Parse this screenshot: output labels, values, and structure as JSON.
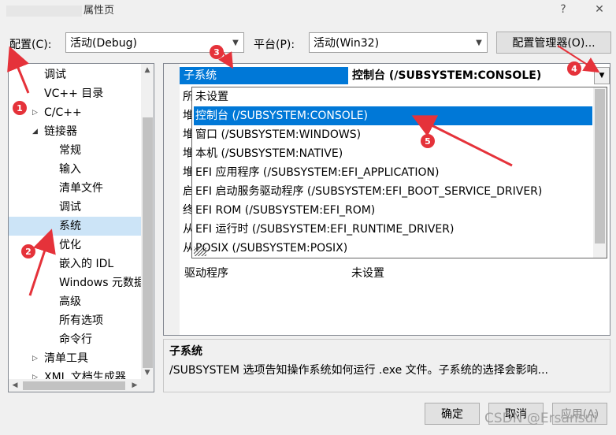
{
  "window": {
    "title": "属性页",
    "help_glyph": "?",
    "close_glyph": "✕"
  },
  "config": {
    "label": "配置(C):",
    "value": "活动(Debug)"
  },
  "platform": {
    "label": "平台(P):",
    "value": "活动(Win32)"
  },
  "config_manager_label": "配置管理器(O)...",
  "tree": {
    "items": [
      {
        "label": "调试",
        "indent": 0
      },
      {
        "label": "VC++ 目录",
        "indent": 0
      },
      {
        "label": "C/C++",
        "indent": 0,
        "expander": "▷"
      },
      {
        "label": "链接器",
        "indent": 0,
        "expander": "◢"
      },
      {
        "label": "常规",
        "indent": 1
      },
      {
        "label": "输入",
        "indent": 1
      },
      {
        "label": "清单文件",
        "indent": 1
      },
      {
        "label": "调试",
        "indent": 1
      },
      {
        "label": "系统",
        "indent": 1,
        "selected": true
      },
      {
        "label": "优化",
        "indent": 1
      },
      {
        "label": "嵌入的 IDL",
        "indent": 1
      },
      {
        "label": "Windows 元数据",
        "indent": 1
      },
      {
        "label": "高级",
        "indent": 1
      },
      {
        "label": "所有选项",
        "indent": 1
      },
      {
        "label": "命令行",
        "indent": 1
      },
      {
        "label": "清单工具",
        "indent": 0,
        "expander": "▷"
      },
      {
        "label": "XML 文档生成器",
        "indent": 0,
        "expander": "▷"
      }
    ]
  },
  "grid": {
    "header_name": "子系统",
    "header_value": "控制台 (/SUBSYSTEM:CONSOLE)",
    "bg_rows": [
      "所",
      "堆",
      "堆",
      "堆",
      "堆",
      "启",
      "终",
      "从",
      "从"
    ],
    "driver_name": "驱动程序",
    "driver_value": "未设置"
  },
  "dropdown": {
    "options": [
      "未设置",
      "控制台 (/SUBSYSTEM:CONSOLE)",
      "窗口 (/SUBSYSTEM:WINDOWS)",
      "本机 (/SUBSYSTEM:NATIVE)",
      "EFI 应用程序 (/SUBSYSTEM:EFI_APPLICATION)",
      "EFI 启动服务驱动程序 (/SUBSYSTEM:EFI_BOOT_SERVICE_DRIVER)",
      "EFI ROM (/SUBSYSTEM:EFI_ROM)",
      "EFI 运行时 (/SUBSYSTEM:EFI_RUNTIME_DRIVER)",
      "POSIX (/SUBSYSTEM:POSIX)"
    ],
    "highlighted_index": 1
  },
  "description": {
    "title": "子系统",
    "text": "/SUBSYSTEM 选项告知操作系统如何运行 .exe 文件。子系统的选择会影响..."
  },
  "buttons": {
    "ok": "确定",
    "cancel": "取消",
    "apply": "应用(A)"
  },
  "watermark": "CSDN @Ersansui",
  "annotations": [
    "1",
    "2",
    "3",
    "4",
    "5"
  ],
  "colors": {
    "highlight": "#0078d7",
    "tree_selected": "#cce4f7",
    "annotation_red": "#e5323a"
  }
}
